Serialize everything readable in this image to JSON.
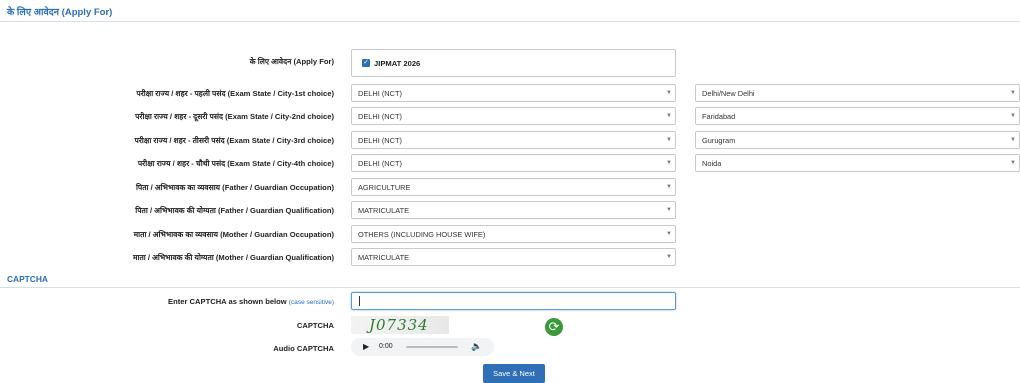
{
  "section_title": "के लिए आवेदन (Apply For)",
  "apply_for": {
    "label": "के लिए आवेदन (Apply For)",
    "option": "JIPMAT 2026",
    "checked": true
  },
  "rows": [
    {
      "label": "परीक्षा राज्य / शहर - पहली पसंद (Exam State / City-1st choice)",
      "state": "DELHI (NCT)",
      "city": "Delhi/New Delhi"
    },
    {
      "label": "परीक्षा राज्य / शहर - दूसरी पसंद (Exam State / City-2nd choice)",
      "state": "DELHI (NCT)",
      "city": "Faridabad"
    },
    {
      "label": "परीक्षा राज्य / शहर - तीसरी पसंद (Exam State / City-3rd choice)",
      "state": "DELHI (NCT)",
      "city": "Gurugram"
    },
    {
      "label": "परीक्षा राज्य / शहर - चौथी पसंद (Exam State / City-4th choice)",
      "state": "DELHI (NCT)",
      "city": "Noida"
    },
    {
      "label": "पिता / अभिभावक का व्यवसाय (Father / Guardian Occupation)",
      "value": "AGRICULTURE"
    },
    {
      "label": "पिता / अभिभावक की योग्यता (Father / Guardian Qualification)",
      "value": "MATRICULATE"
    },
    {
      "label": "माता / अभिभावक का व्यवसाय (Mother / Guardian Occupation)",
      "value": "OTHERS (INCLUDING HOUSE WIFE)"
    },
    {
      "label": "माता / अभिभावक की योग्यता (Mother / Guardian Qualification)",
      "value": "MATRICULATE"
    }
  ],
  "captcha": {
    "heading": "CAPTCHA",
    "enter_label": "Enter CAPTCHA as shown below",
    "case_note": "(case sensitive)",
    "input_value": "",
    "image_label": "CAPTCHA",
    "image_text": "J07334",
    "audio_label": "Audio CAPTCHA",
    "audio_time": "0:00"
  },
  "save_button": "Save & Next",
  "icons": {
    "dropdown": "chevron-down-icon",
    "refresh": "refresh-icon",
    "play": "play-icon",
    "volume": "volume-icon"
  }
}
